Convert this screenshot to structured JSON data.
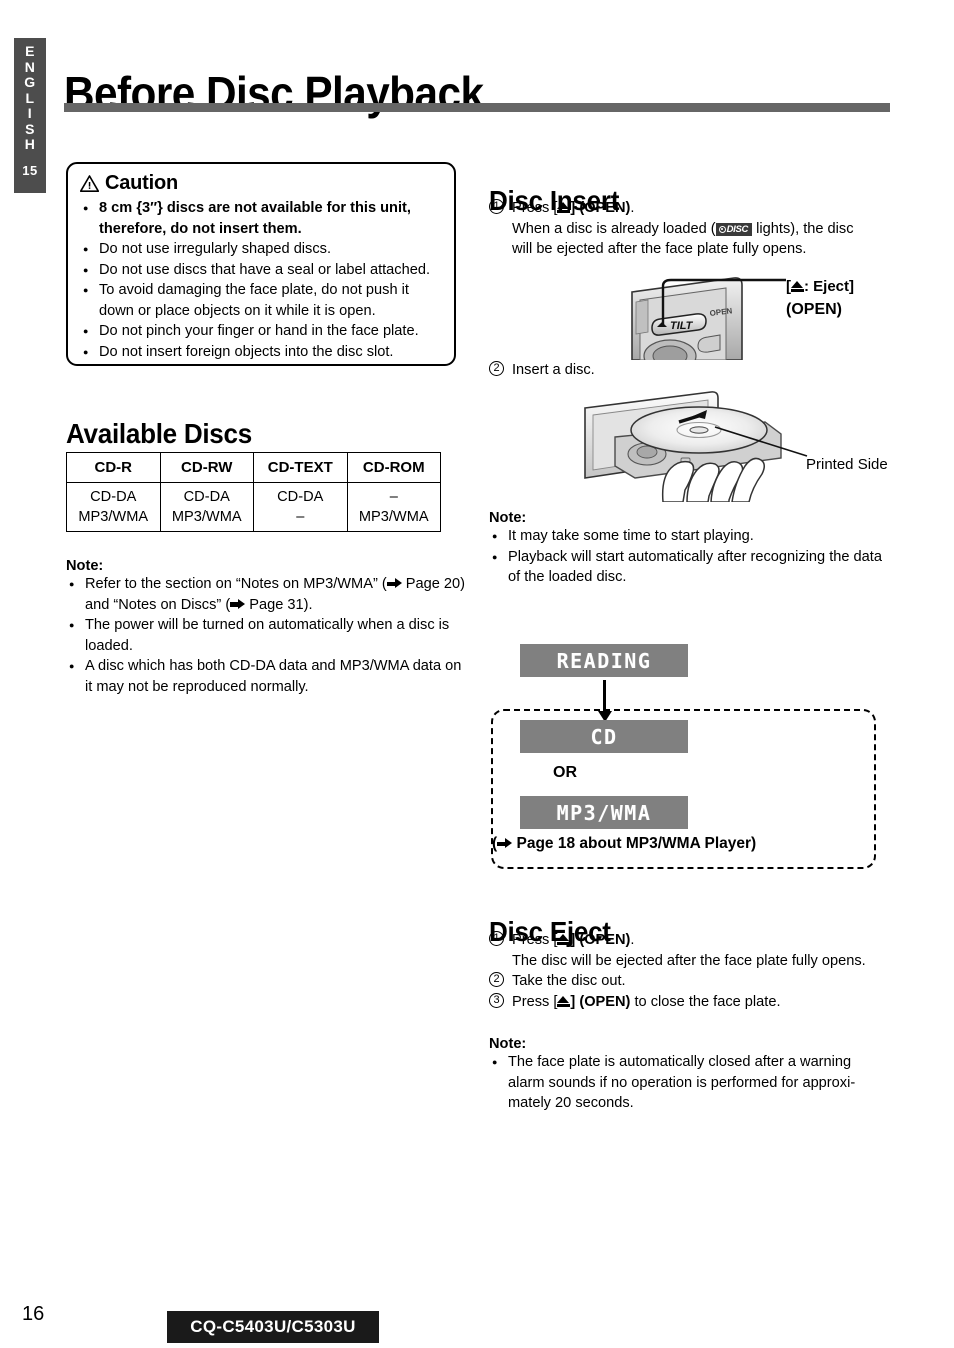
{
  "sidebar": {
    "language": "ENGLISH",
    "letters": [
      "E",
      "N",
      "G",
      "L",
      "I",
      "S",
      "H"
    ],
    "section_number": "15"
  },
  "page_title": "Before Disc Playback",
  "caution": {
    "heading": "Caution",
    "warning_icon": "warning-triangle-icon",
    "items": [
      {
        "text": "8 cm {3″} discs are not available for this unit, therefore, do not insert them.",
        "bold": true
      },
      {
        "text": "Do not use irregularly shaped discs.",
        "bold": false
      },
      {
        "text": "Do not use discs that have a seal or label attached.",
        "bold": false
      },
      {
        "text": "To avoid damaging the face plate, do not push it down or place objects on it while it is open.",
        "bold": false
      },
      {
        "text": "Do not pinch your finger or hand in the face plate.",
        "bold": false
      },
      {
        "text": "Do not insert foreign objects into the disc slot.",
        "bold": false
      }
    ]
  },
  "available_discs": {
    "heading": "Available Discs",
    "columns": [
      "CD-R",
      "CD-RW",
      "CD-TEXT",
      "CD-ROM"
    ],
    "rows": [
      [
        "CD-DA",
        "CD-DA",
        "CD-DA",
        "–"
      ],
      [
        "MP3/WMA",
        "MP3/WMA",
        "–",
        "MP3/WMA"
      ]
    ]
  },
  "note_discs": {
    "heading": "Note:",
    "items": [
      "Refer to the section on “Notes on MP3/WMA” (➡ Page 20) and “Notes on Discs” (➡ Page 31).",
      "The power will be turned on automatically when a disc is loaded.",
      "A disc which has both CD-DA data and MP3/WMA data on it may not be reproduced normally."
    ],
    "item1_parts": {
      "a": "Refer to the section on “Notes on MP3/WMA” (",
      "b": "Page 20) and “Notes on Discs” (",
      "c": "Page 31)."
    }
  },
  "disc_insert": {
    "heading": "Disc Insert",
    "step1": {
      "number": "1",
      "press": "Press [",
      "open": "] (OPEN)",
      "period": ".",
      "detail_a": "When a disc is already loaded (",
      "badge": "DISC",
      "detail_b": "lights), the disc",
      "detail_c": "will be ejected after the face plate fully opens."
    },
    "step2": {
      "number": "2",
      "text": "Insert a disc."
    },
    "eject_callout": {
      "line1_prefix": "[",
      "line1_suffix": ": Eject]",
      "line2": "(OPEN)"
    },
    "faceplate_button_label": "TILT",
    "faceplate_open_label": "OPEN",
    "printed_side_label": "Printed Side"
  },
  "note_insert": {
    "heading": "Note:",
    "items": [
      "It may take some time to start playing.",
      "Playback will start automatically after recognizing the data of the loaded disc."
    ]
  },
  "display_flow": {
    "reading": "READING",
    "cd": "CD",
    "mp3wma": "MP3/WMA",
    "or_label": "OR",
    "page_ref_prefix": "(",
    "page_ref": "Page 18 about MP3/WMA Player)"
  },
  "disc_eject": {
    "heading": "Disc Eject",
    "steps": [
      {
        "number": "1",
        "press": "Press [",
        "open": "] (OPEN)",
        "tail": "."
      },
      {
        "number": "2",
        "text": "Take the disc out."
      },
      {
        "number": "3",
        "press": "Press [",
        "open": "] (OPEN)",
        "tail": " to close the face plate."
      }
    ],
    "step1_detail": "The disc will be ejected after the face plate fully opens."
  },
  "note_eject": {
    "heading": "Note:",
    "items": [
      "The face plate is automatically closed after a warning alarm sounds if no operation is performed for approxi-mately 20 seconds."
    ]
  },
  "footer": {
    "page_number": "16",
    "model": "CQ-C5403U/C5303U"
  },
  "colors": {
    "tab_grey": "#4d4d4d",
    "rule_grey": "#666666",
    "lcd_grey": "#808080",
    "badge_black": "#1a1a1a"
  }
}
